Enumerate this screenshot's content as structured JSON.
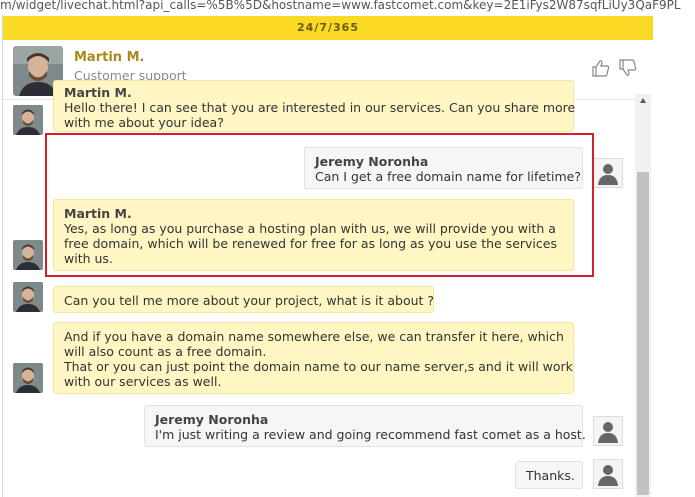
{
  "browser": {
    "url": "m/widget/livechat.html?api_calls=%5B%5D&hostname=www.fastcomet.com&key=2E1iFys2W87sqfLiUy3QaF9PL"
  },
  "widget": {
    "topbar_text": "24/7/365",
    "agent": {
      "name": "Martin M.",
      "role": "Customer support"
    }
  },
  "messages": [
    {
      "sender": "agent",
      "author": "Martin M.",
      "lines": [
        "Hello there! I can see that you are interested in our services. Can you share more",
        "with me about your idea?"
      ]
    },
    {
      "sender": "user",
      "author": "Jeremy Noronha",
      "lines": [
        "Can I get a free domain name for lifetime?"
      ]
    },
    {
      "sender": "agent",
      "author": "Martin M.",
      "lines": [
        "Yes, as long as you purchase a hosting plan with us, we will provide you with a",
        "free domain, which will be renewed for free for as long as you use the services",
        "with us."
      ]
    },
    {
      "sender": "agent",
      "lines": [
        "Can you tell me more about your project, what is it about ?"
      ]
    },
    {
      "sender": "agent",
      "lines": [
        "And if you have a domain name somewhere else, we can transfer it here, which",
        "will also count as a free domain.",
        "That or you can just point the domain name to our name server,s and it will work",
        "with our services as well."
      ]
    },
    {
      "sender": "user",
      "author": "Jeremy Noronha",
      "lines": [
        "I'm just writing a review and going recommend fast comet as a host."
      ]
    },
    {
      "sender": "user",
      "lines": [
        "Thanks."
      ]
    }
  ],
  "colors": {
    "topbar": "#f9d923",
    "agent_name": "#a8891a",
    "agent_bubble": "#fff6c4",
    "user_bubble": "#f6f6f6",
    "highlight": "#d32027"
  }
}
